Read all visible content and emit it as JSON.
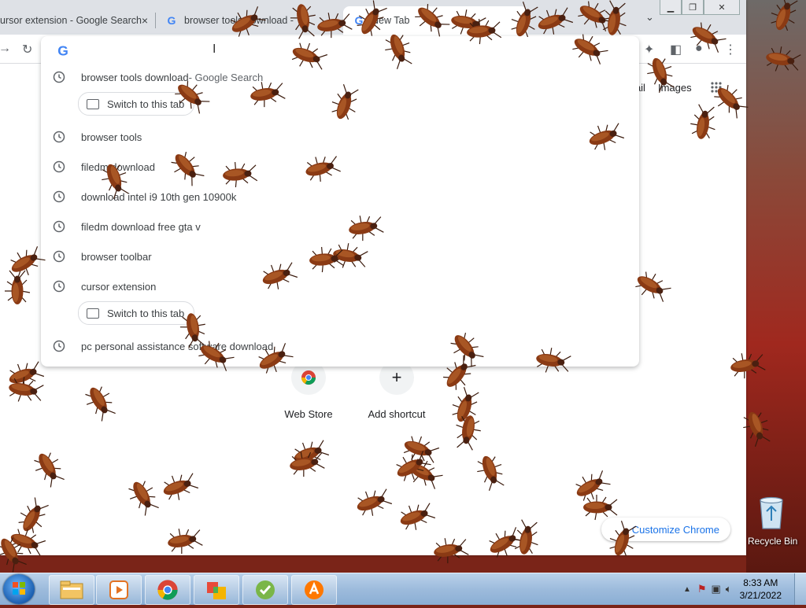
{
  "window": {
    "tabs": [
      {
        "label": "ursor extension - Google Search",
        "close": "×"
      },
      {
        "label": "browser tools download -"
      },
      {
        "label": "New Tab"
      }
    ],
    "tab_menu_icon": "chevron-down-icon"
  },
  "ntp": {
    "links": [
      "Gmail",
      "Images"
    ],
    "shortcuts": [
      {
        "label": "Web Store",
        "icon": "chrome-web-store-icon"
      },
      {
        "label": "Add shortcut",
        "icon": "plus-icon"
      }
    ],
    "customize_label": "Customize Chrome"
  },
  "omnibox": {
    "switch_label": "Switch to this tab",
    "suggestions": [
      {
        "text": "browser tools download",
        "sub": " - Google Search",
        "switch": true
      },
      {
        "text": "browser tools"
      },
      {
        "text": "filedm download"
      },
      {
        "text": "download intel i9 10th gen 10900k"
      },
      {
        "text": "filedm download free gta v"
      },
      {
        "text": "browser toolbar"
      },
      {
        "text": "cursor extension",
        "switch": true
      },
      {
        "text": "pc personal assistance software download"
      }
    ]
  },
  "desktop": {
    "recycle_bin": "Recycle Bin"
  },
  "taskbar": {
    "apps": [
      "explorer-icon",
      "media-player-icon",
      "chrome-icon",
      "app-icon",
      "security-icon",
      "avast-icon"
    ],
    "time": "8:33 AM",
    "date": "3/21/2022"
  },
  "colors": {
    "accent": "#1a73e8",
    "tabstrip": "#dee1e6",
    "taskbar": "#9dbbdc"
  }
}
